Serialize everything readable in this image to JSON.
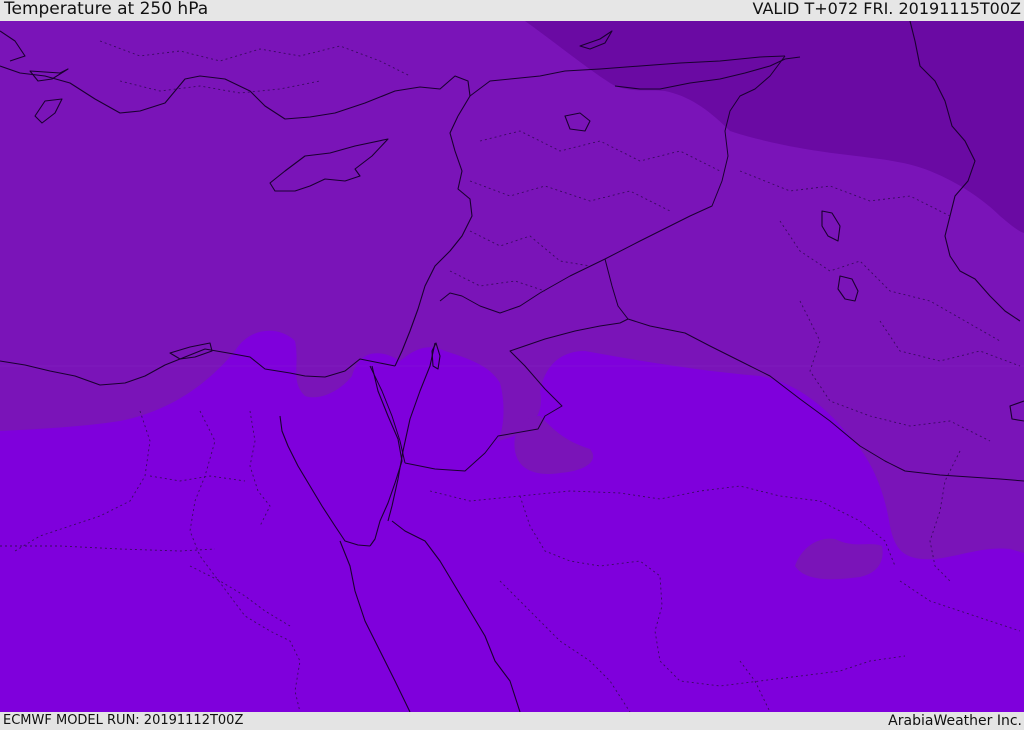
{
  "header": {
    "title": "Temperature at 250 hPa",
    "valid": "VALID T+072 FRI. 20191115T00Z"
  },
  "footer": {
    "model_run": "ECMWF MODEL RUN: 20191112T00Z",
    "credit": "ArabiaWeather Inc."
  },
  "colors": {
    "warm_band": "#7f00dc",
    "mid_band": "#7a14b8",
    "cold_band": "#6a0aa3",
    "coast_lines": "#1a0030",
    "border_lines": "#3a0a60"
  }
}
